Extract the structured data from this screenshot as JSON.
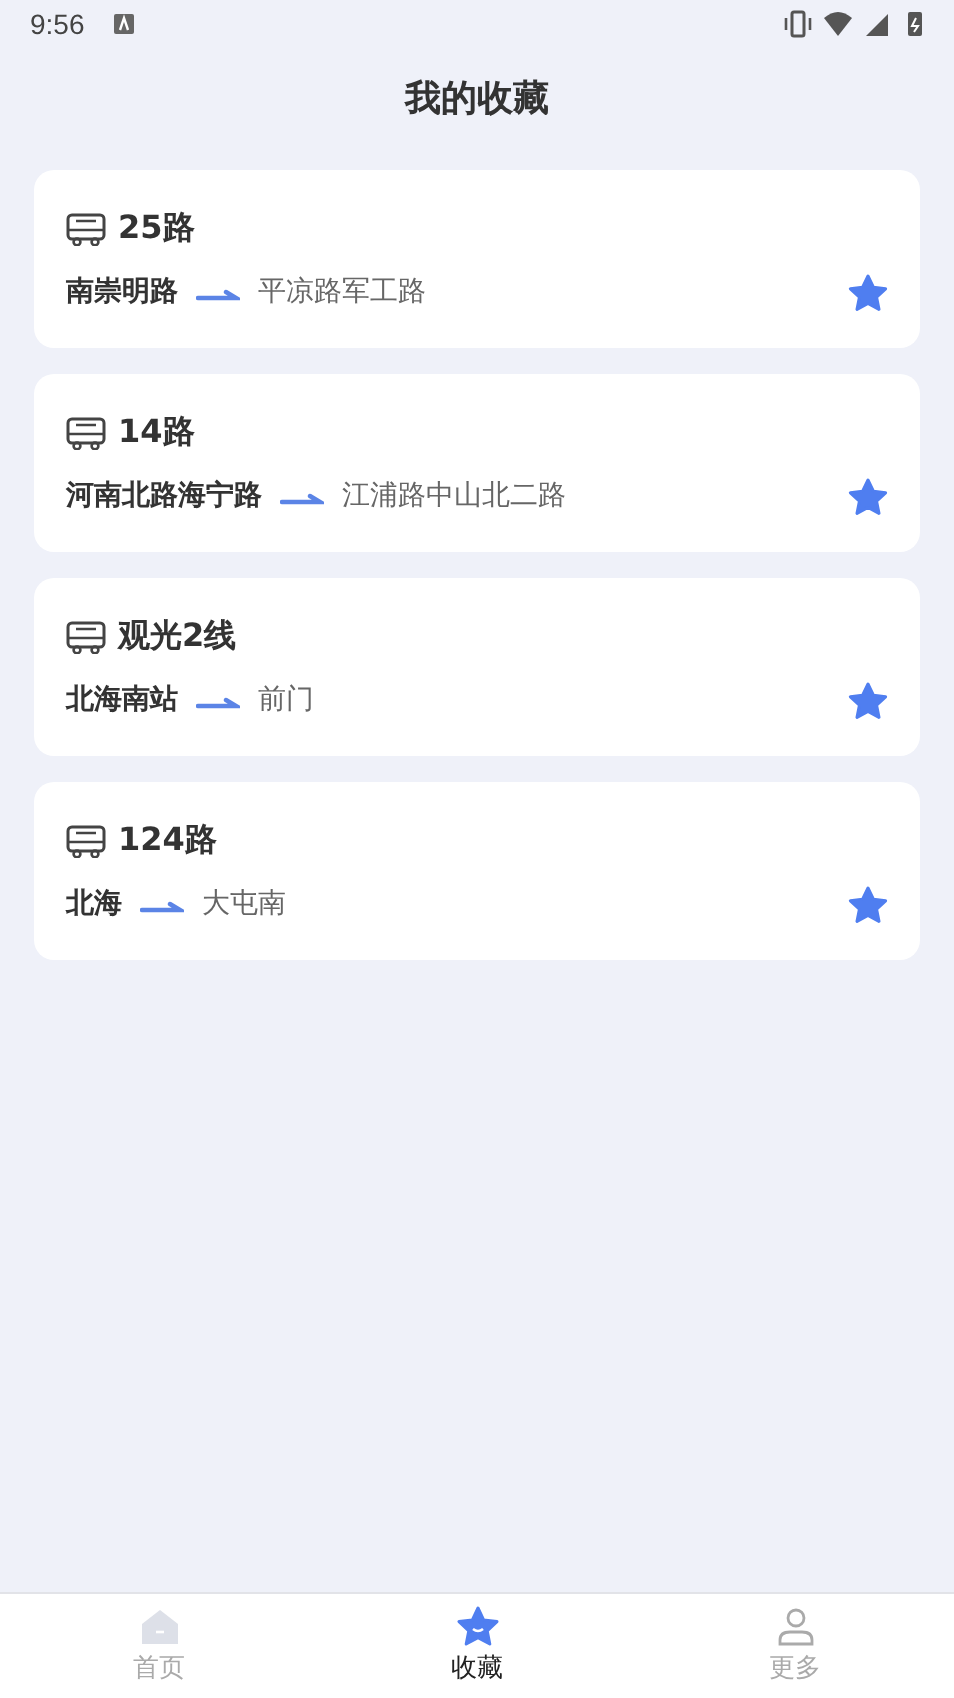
{
  "status_bar": {
    "time": "9:56"
  },
  "header": {
    "title": "我的收藏"
  },
  "favorites": [
    {
      "route": "25路",
      "from": "南崇明路",
      "to": "平凉路军工路",
      "favorited": true
    },
    {
      "route": "14路",
      "from": "河南北路海宁路",
      "to": "江浦路中山北二路",
      "favorited": true
    },
    {
      "route": "观光2线",
      "from": "北海南站",
      "to": "前门",
      "favorited": true
    },
    {
      "route": "124路",
      "from": "北海",
      "to": "大屯南",
      "favorited": true
    }
  ],
  "tab_bar": [
    {
      "label": "首页",
      "kind": "home",
      "selected": false
    },
    {
      "label": "收藏",
      "kind": "star",
      "selected": true
    },
    {
      "label": "更多",
      "kind": "person",
      "selected": false
    }
  ]
}
